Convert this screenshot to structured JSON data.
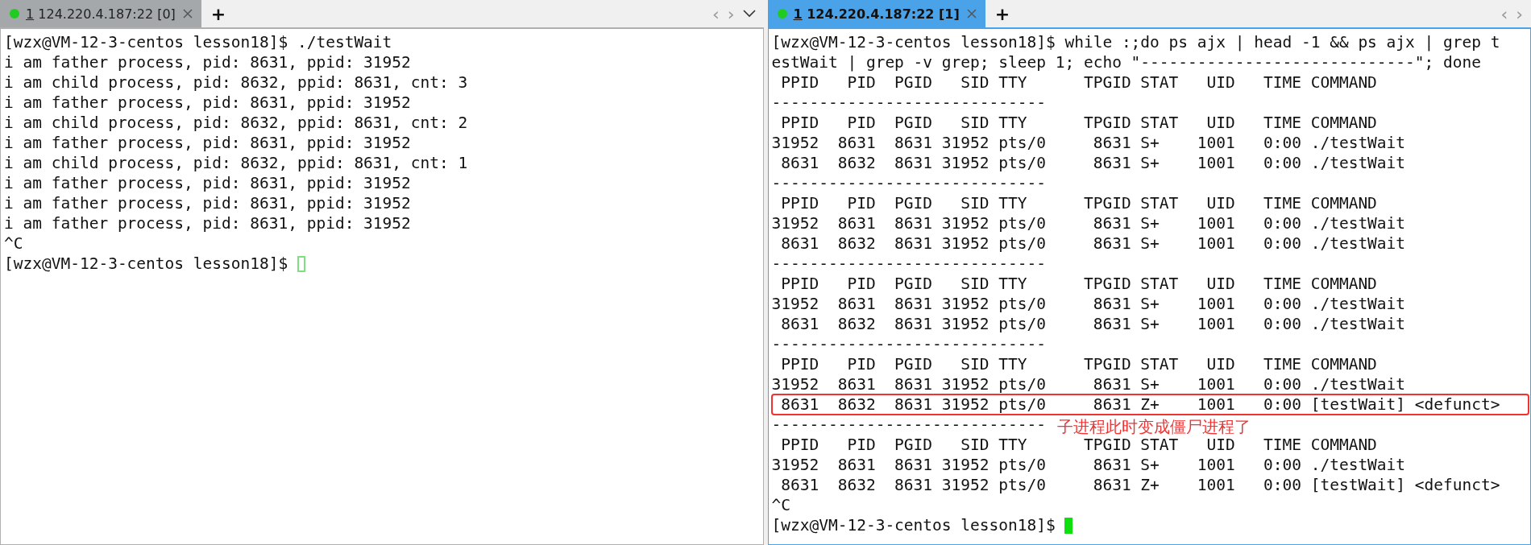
{
  "panes": [
    {
      "tab": {
        "number": "1",
        "title": "124.220.4.187:22 [0]",
        "selected": false
      },
      "focused": false,
      "new_tab": "+",
      "nav": {
        "prev": "‹",
        "next": "›",
        "menu": true
      },
      "lines": [
        {
          "text": "[wzx@VM-12-3-centos lesson18]$ ./testWait"
        },
        {
          "text": "i am father process, pid: 8631, ppid: 31952"
        },
        {
          "text": "i am child process, pid: 8632, ppid: 8631, cnt: 3"
        },
        {
          "text": "i am father process, pid: 8631, ppid: 31952"
        },
        {
          "text": "i am child process, pid: 8632, ppid: 8631, cnt: 2"
        },
        {
          "text": "i am father process, pid: 8631, ppid: 31952"
        },
        {
          "text": "i am child process, pid: 8632, ppid: 8631, cnt: 1"
        },
        {
          "text": "i am father process, pid: 8631, ppid: 31952"
        },
        {
          "text": "i am father process, pid: 8631, ppid: 31952"
        },
        {
          "text": "i am father process, pid: 8631, ppid: 31952"
        },
        {
          "text": "^C"
        },
        {
          "text": "[wzx@VM-12-3-centos lesson18]$ "
        }
      ]
    },
    {
      "tab": {
        "number": "1",
        "title": "124.220.4.187:22 [1]",
        "selected": true
      },
      "focused": true,
      "new_tab": "+",
      "nav": {
        "prev": "‹",
        "next": "›",
        "menu": false
      },
      "lines": [
        {
          "text": "[wzx@VM-12-3-centos lesson18]$ while :;do ps ajx | head -1 && ps ajx | grep t"
        },
        {
          "text": "estWait | grep -v grep; sleep 1; echo \"-----------------------------\"; done"
        },
        {
          "text": " PPID   PID  PGID   SID TTY      TPGID STAT   UID   TIME COMMAND"
        },
        {
          "text": "-----------------------------"
        },
        {
          "text": " PPID   PID  PGID   SID TTY      TPGID STAT   UID   TIME COMMAND"
        },
        {
          "text": "31952  8631  8631 31952 pts/0     8631 S+    1001   0:00 ./testWait"
        },
        {
          "text": " 8631  8632  8631 31952 pts/0     8631 S+    1001   0:00 ./testWait"
        },
        {
          "text": "-----------------------------"
        },
        {
          "text": " PPID   PID  PGID   SID TTY      TPGID STAT   UID   TIME COMMAND"
        },
        {
          "text": "31952  8631  8631 31952 pts/0     8631 S+    1001   0:00 ./testWait"
        },
        {
          "text": " 8631  8632  8631 31952 pts/0     8631 S+    1001   0:00 ./testWait"
        },
        {
          "text": "-----------------------------"
        },
        {
          "text": " PPID   PID  PGID   SID TTY      TPGID STAT   UID   TIME COMMAND"
        },
        {
          "text": "31952  8631  8631 31952 pts/0     8631 S+    1001   0:00 ./testWait"
        },
        {
          "text": " 8631  8632  8631 31952 pts/0     8631 S+    1001   0:00 ./testWait"
        },
        {
          "text": "-----------------------------"
        },
        {
          "text": " PPID   PID  PGID   SID TTY      TPGID STAT   UID   TIME COMMAND"
        },
        {
          "text": "31952  8631  8631 31952 pts/0     8631 S+    1001   0:00 ./testWait"
        },
        {
          "text": " 8631  8632  8631 31952 pts/0     8631 Z+    1001   0:00 [testWait] <defunct>",
          "boxed": true
        },
        {
          "text": "-----------------------------",
          "annotation": "子进程此时变成僵尸进程了"
        },
        {
          "text": " PPID   PID  PGID   SID TTY      TPGID STAT   UID   TIME COMMAND"
        },
        {
          "text": "31952  8631  8631 31952 pts/0     8631 S+    1001   0:00 ./testWait"
        },
        {
          "text": " 8631  8632  8631 31952 pts/0     8631 Z+    1001   0:00 [testWait] <defunct>"
        },
        {
          "text": "^C"
        },
        {
          "text": "[wzx@VM-12-3-centos lesson18]$ "
        }
      ]
    }
  ]
}
